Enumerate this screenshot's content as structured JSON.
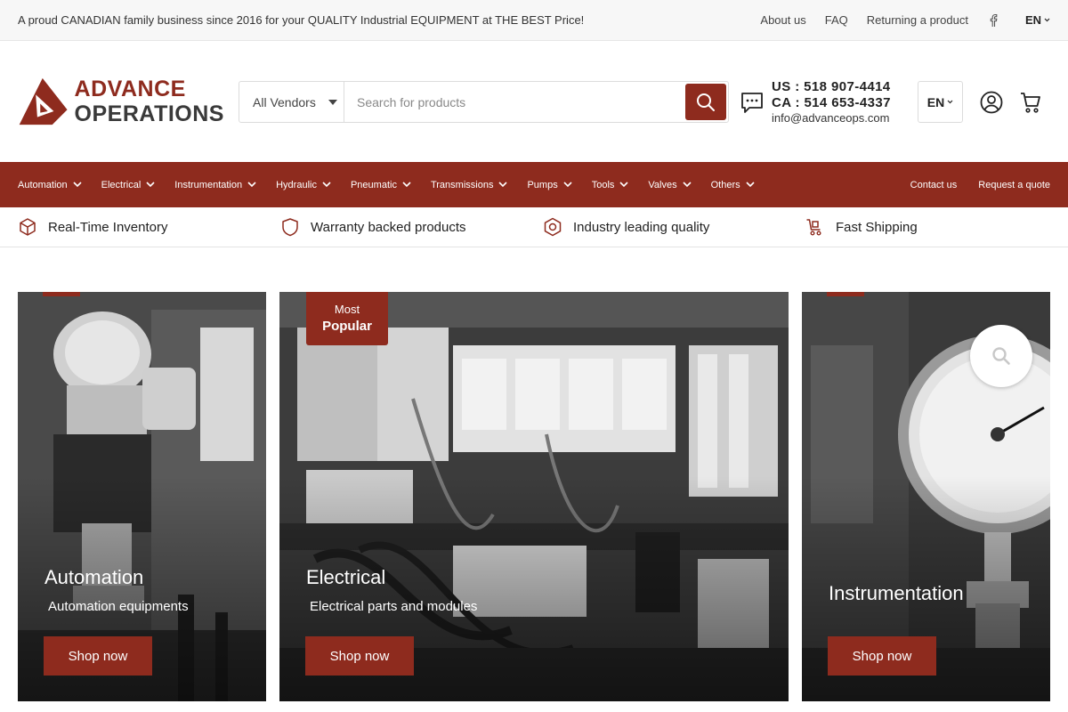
{
  "topbar": {
    "announcement": "A proud CANADIAN family business since 2016 for your QUALITY Industrial EQUIPMENT at THE BEST Price!",
    "links": [
      "About us",
      "FAQ",
      "Returning a product"
    ],
    "language": "EN"
  },
  "header": {
    "logo_line1": "ADVANCE",
    "logo_line2": "OPERATIONS",
    "vendor_select": "All Vendors",
    "search_placeholder": "Search for products",
    "phone_us": "US : 518 907-4414",
    "phone_ca": "CA : 514 653-4337",
    "email": "info@advanceops.com",
    "language": "EN"
  },
  "nav": {
    "items": [
      "Automation",
      "Electrical",
      "Instrumentation",
      "Hydraulic",
      "Pneumatic",
      "Transmissions",
      "Pumps",
      "Tools",
      "Valves",
      "Others"
    ],
    "contact": "Contact us",
    "quote": "Request a quote"
  },
  "features": [
    {
      "label": "Real-Time Inventory",
      "icon": "box-icon"
    },
    {
      "label": "Warranty backed products",
      "icon": "shield-icon"
    },
    {
      "label": "Industry leading quality",
      "icon": "hexagon-icon"
    },
    {
      "label": "Fast Shipping",
      "icon": "cart-shipping-icon"
    }
  ],
  "cards": [
    {
      "title": "Automation",
      "description": "Automation equipments",
      "button": "Shop now"
    },
    {
      "title": "Electrical",
      "description": "Electrical parts and modules",
      "button": "Shop now",
      "badge_line1": "Most",
      "badge_line2": "Popular"
    },
    {
      "title": "Instrumentation",
      "button": "Shop now"
    }
  ],
  "colors": {
    "brand": "#8e2b1e",
    "topbar_bg": "#f7f7f7"
  }
}
